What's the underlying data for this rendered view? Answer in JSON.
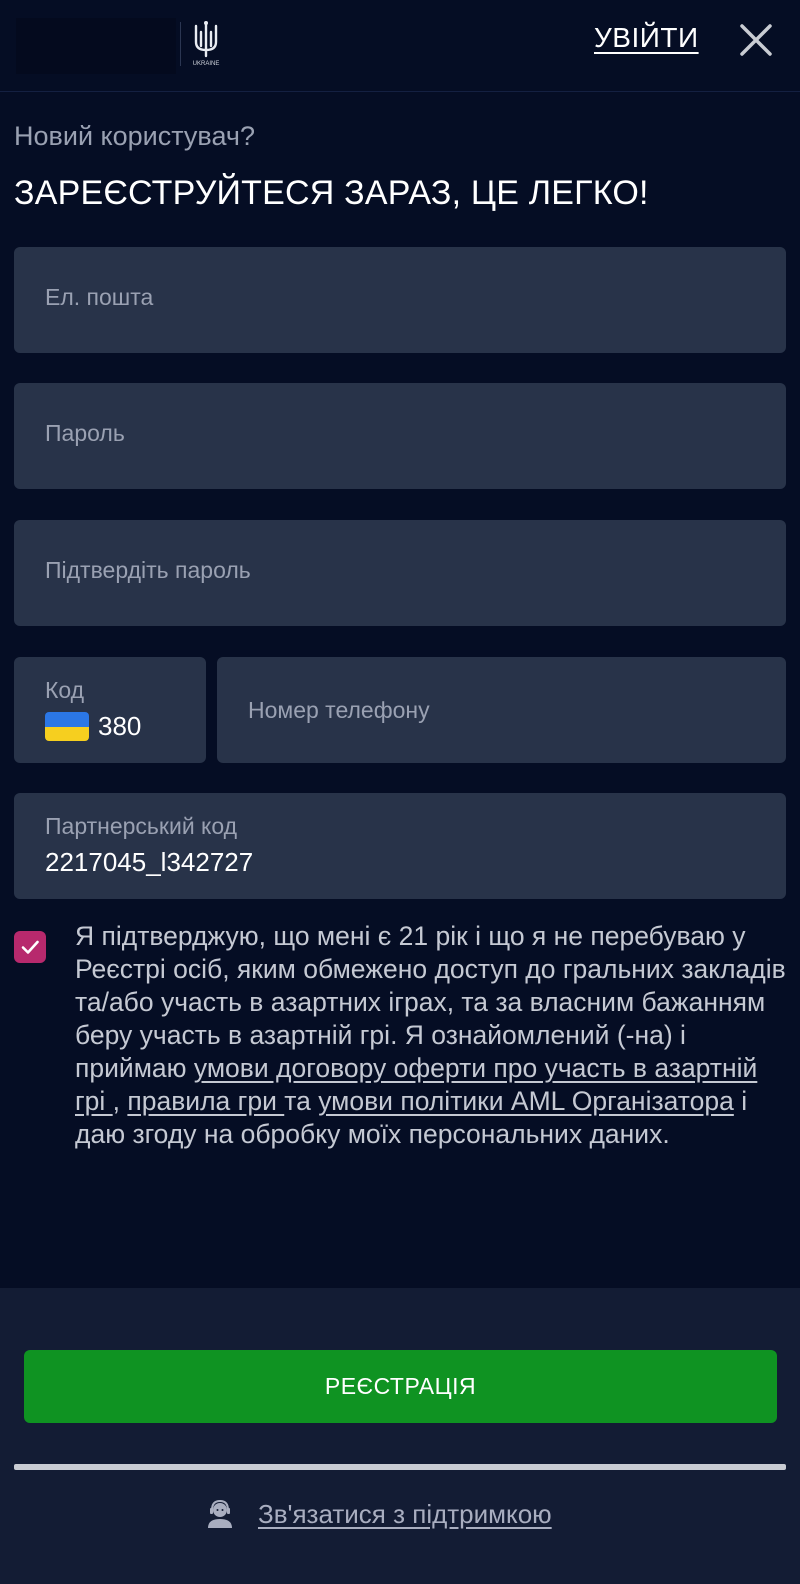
{
  "header": {
    "logo_icon": "trident-icon",
    "logo_caption": "UKRAINE",
    "login_label": "УВІЙТИ",
    "close_icon": "close-icon"
  },
  "intro": {
    "subtitle": "Новий користувач?",
    "title": "ЗАРЕЄСТРУЙТЕСЯ ЗАРАЗ, ЦЕ ЛЕГКО!"
  },
  "form": {
    "email_placeholder": "Ел. пошта",
    "password_placeholder": "Пароль",
    "confirm_password_placeholder": "Підтвердіть пароль",
    "code_label": "Код",
    "code_value": "380",
    "phone_placeholder": "Номер телефону",
    "partner_label": "Партнерський код",
    "partner_value": "2217045_l342727"
  },
  "consent": {
    "checked": true,
    "text_1": "Я підтверджую, що мені є 21 рік і що я не перебуваю у Реєстрі осіб, яким обмежено доступ до гральних закладів та/або участь в азартних іграх, та за власним бажанням беру участь в азартній грі. Я ознайомлений (-на) і приймаю ",
    "link_1": "умови договору оферти про участь в азартній грі ",
    "sep_1": ", ",
    "link_2": "правила гри ",
    "text_2": "та ",
    "link_3": "умови політики AML Організатора",
    "text_3": " і даю згоду на обробку моїх персональних даних."
  },
  "footer": {
    "register_label": "РЕЄСТРАЦІЯ",
    "support_label": "Зв'язатися з підтримкою",
    "support_icon": "support-agent-icon"
  },
  "colors": {
    "background": "#050d24",
    "field": "#283349",
    "checkbox": "#b7296d",
    "register": "#0f9322",
    "footer": "#131c34"
  }
}
